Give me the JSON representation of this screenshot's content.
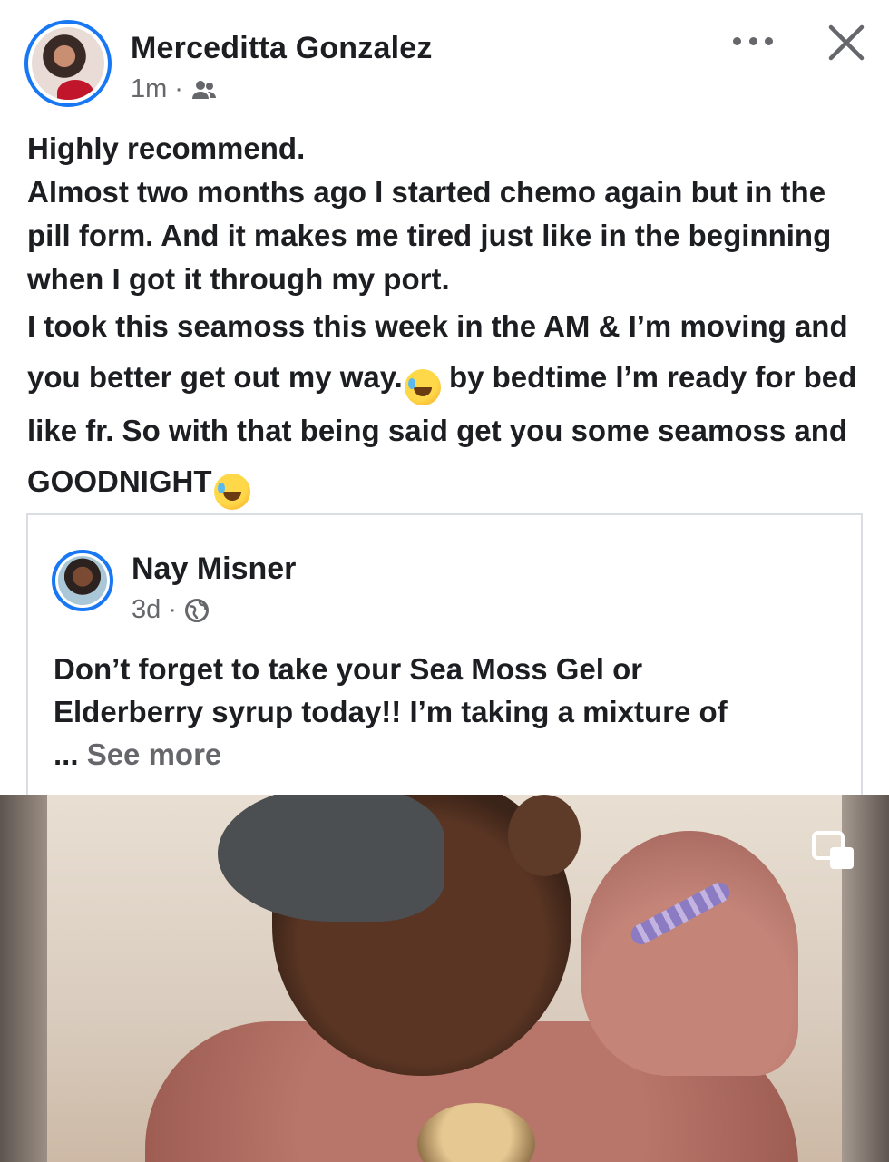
{
  "post": {
    "author": "Merceditta Gonzalez",
    "time": "1m",
    "separator": "·",
    "audience_icon": "friends-icon",
    "text_lines": [
      "Highly recommend.",
      "Almost two months ago I started chemo again but in the pill form. And it makes me tired just like in the beginning when I got it through my port.",
      "I took this seamoss this week in the AM & I’m moving and you better get out my way.",
      " by bedtime I’m ready for bed like fr. So with that being said get you some seamoss and GOODNIGHT"
    ],
    "emoji": "🤣"
  },
  "shared": {
    "author": "Nay Misner",
    "time": "3d",
    "separator": "·",
    "audience_icon": "globe-icon",
    "text_line_1": "Don’t forget to take your Sea Moss Gel or",
    "text_line_2": "Elderberry syrup today!! I’m taking a mixture of",
    "ellipsis": "...",
    "see_more": "See more"
  },
  "icons": {
    "more": "more-options-icon",
    "close": "close-icon",
    "pip": "picture-in-picture-icon"
  },
  "colors": {
    "accent": "#1877f2",
    "text": "#1c1e21",
    "secondary": "#65676b",
    "border": "#dadde1"
  }
}
